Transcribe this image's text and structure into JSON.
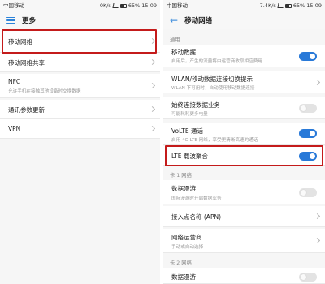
{
  "left": {
    "status": {
      "carrier": "中国移动",
      "speed": "0K/s",
      "battery": "65%",
      "time": "15:09"
    },
    "title": "更多",
    "items": [
      {
        "label": "移动网络",
        "sub": ""
      },
      {
        "label": "移动网络共享",
        "sub": ""
      },
      {
        "label": "NFC",
        "sub": "允许手机在接触其他设备时交换数据"
      },
      {
        "label": "通讯参数更新",
        "sub": ""
      },
      {
        "label": "VPN",
        "sub": ""
      }
    ]
  },
  "right": {
    "status": {
      "carrier": "中国移动",
      "speed": "7.4K/s",
      "battery": "65%",
      "time": "15:09"
    },
    "title": "移动网络",
    "section_general": "通用",
    "section_card1": "卡 1 网络",
    "section_card2": "卡 2 网络",
    "items": [
      {
        "label": "移动数据",
        "sub": "启用后，产生的流量将由运营商收取相应费用",
        "toggle": "on"
      },
      {
        "label": "WLAN/移动数据连接切换提示",
        "sub": "WLAN 不可用时，自动使用移动数据连接",
        "toggle": ""
      },
      {
        "label": "始终连接数据业务",
        "sub": "可能耗耗更多电量",
        "toggle": "off"
      },
      {
        "label": "VoLTE 通话",
        "sub": "启用 4G LTE 网络，享受更清晰高速的通话",
        "toggle": "on"
      },
      {
        "label": "LTE 载波聚合",
        "sub": "",
        "toggle": "on"
      },
      {
        "label": "数据漫游",
        "sub": "国际漫游时开启数据业务",
        "toggle": "off"
      },
      {
        "label": "接入点名称 (APN)",
        "sub": "",
        "toggle": ""
      },
      {
        "label": "网络运营商",
        "sub": "手动或自动选择",
        "toggle": ""
      },
      {
        "label": "数据漫游",
        "sub": "",
        "toggle": "off"
      }
    ]
  }
}
